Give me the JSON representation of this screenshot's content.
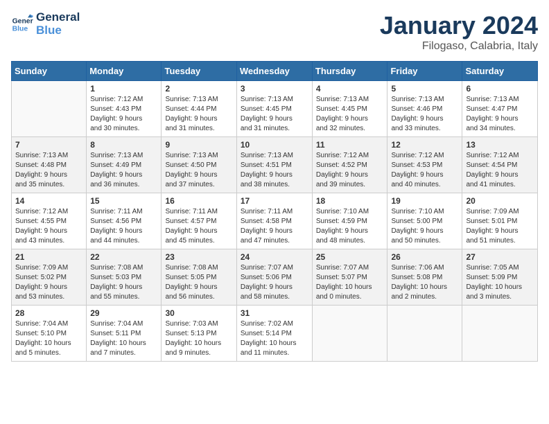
{
  "header": {
    "logo_line1": "General",
    "logo_line2": "Blue",
    "month": "January 2024",
    "location": "Filogaso, Calabria, Italy"
  },
  "weekdays": [
    "Sunday",
    "Monday",
    "Tuesday",
    "Wednesday",
    "Thursday",
    "Friday",
    "Saturday"
  ],
  "weeks": [
    [
      {
        "day": "",
        "info": ""
      },
      {
        "day": "1",
        "info": "Sunrise: 7:12 AM\nSunset: 4:43 PM\nDaylight: 9 hours\nand 30 minutes."
      },
      {
        "day": "2",
        "info": "Sunrise: 7:13 AM\nSunset: 4:44 PM\nDaylight: 9 hours\nand 31 minutes."
      },
      {
        "day": "3",
        "info": "Sunrise: 7:13 AM\nSunset: 4:45 PM\nDaylight: 9 hours\nand 31 minutes."
      },
      {
        "day": "4",
        "info": "Sunrise: 7:13 AM\nSunset: 4:45 PM\nDaylight: 9 hours\nand 32 minutes."
      },
      {
        "day": "5",
        "info": "Sunrise: 7:13 AM\nSunset: 4:46 PM\nDaylight: 9 hours\nand 33 minutes."
      },
      {
        "day": "6",
        "info": "Sunrise: 7:13 AM\nSunset: 4:47 PM\nDaylight: 9 hours\nand 34 minutes."
      }
    ],
    [
      {
        "day": "7",
        "info": "Sunrise: 7:13 AM\nSunset: 4:48 PM\nDaylight: 9 hours\nand 35 minutes."
      },
      {
        "day": "8",
        "info": "Sunrise: 7:13 AM\nSunset: 4:49 PM\nDaylight: 9 hours\nand 36 minutes."
      },
      {
        "day": "9",
        "info": "Sunrise: 7:13 AM\nSunset: 4:50 PM\nDaylight: 9 hours\nand 37 minutes."
      },
      {
        "day": "10",
        "info": "Sunrise: 7:13 AM\nSunset: 4:51 PM\nDaylight: 9 hours\nand 38 minutes."
      },
      {
        "day": "11",
        "info": "Sunrise: 7:12 AM\nSunset: 4:52 PM\nDaylight: 9 hours\nand 39 minutes."
      },
      {
        "day": "12",
        "info": "Sunrise: 7:12 AM\nSunset: 4:53 PM\nDaylight: 9 hours\nand 40 minutes."
      },
      {
        "day": "13",
        "info": "Sunrise: 7:12 AM\nSunset: 4:54 PM\nDaylight: 9 hours\nand 41 minutes."
      }
    ],
    [
      {
        "day": "14",
        "info": "Sunrise: 7:12 AM\nSunset: 4:55 PM\nDaylight: 9 hours\nand 43 minutes."
      },
      {
        "day": "15",
        "info": "Sunrise: 7:11 AM\nSunset: 4:56 PM\nDaylight: 9 hours\nand 44 minutes."
      },
      {
        "day": "16",
        "info": "Sunrise: 7:11 AM\nSunset: 4:57 PM\nDaylight: 9 hours\nand 45 minutes."
      },
      {
        "day": "17",
        "info": "Sunrise: 7:11 AM\nSunset: 4:58 PM\nDaylight: 9 hours\nand 47 minutes."
      },
      {
        "day": "18",
        "info": "Sunrise: 7:10 AM\nSunset: 4:59 PM\nDaylight: 9 hours\nand 48 minutes."
      },
      {
        "day": "19",
        "info": "Sunrise: 7:10 AM\nSunset: 5:00 PM\nDaylight: 9 hours\nand 50 minutes."
      },
      {
        "day": "20",
        "info": "Sunrise: 7:09 AM\nSunset: 5:01 PM\nDaylight: 9 hours\nand 51 minutes."
      }
    ],
    [
      {
        "day": "21",
        "info": "Sunrise: 7:09 AM\nSunset: 5:02 PM\nDaylight: 9 hours\nand 53 minutes."
      },
      {
        "day": "22",
        "info": "Sunrise: 7:08 AM\nSunset: 5:03 PM\nDaylight: 9 hours\nand 55 minutes."
      },
      {
        "day": "23",
        "info": "Sunrise: 7:08 AM\nSunset: 5:05 PM\nDaylight: 9 hours\nand 56 minutes."
      },
      {
        "day": "24",
        "info": "Sunrise: 7:07 AM\nSunset: 5:06 PM\nDaylight: 9 hours\nand 58 minutes."
      },
      {
        "day": "25",
        "info": "Sunrise: 7:07 AM\nSunset: 5:07 PM\nDaylight: 10 hours\nand 0 minutes."
      },
      {
        "day": "26",
        "info": "Sunrise: 7:06 AM\nSunset: 5:08 PM\nDaylight: 10 hours\nand 2 minutes."
      },
      {
        "day": "27",
        "info": "Sunrise: 7:05 AM\nSunset: 5:09 PM\nDaylight: 10 hours\nand 3 minutes."
      }
    ],
    [
      {
        "day": "28",
        "info": "Sunrise: 7:04 AM\nSunset: 5:10 PM\nDaylight: 10 hours\nand 5 minutes."
      },
      {
        "day": "29",
        "info": "Sunrise: 7:04 AM\nSunset: 5:11 PM\nDaylight: 10 hours\nand 7 minutes."
      },
      {
        "day": "30",
        "info": "Sunrise: 7:03 AM\nSunset: 5:13 PM\nDaylight: 10 hours\nand 9 minutes."
      },
      {
        "day": "31",
        "info": "Sunrise: 7:02 AM\nSunset: 5:14 PM\nDaylight: 10 hours\nand 11 minutes."
      },
      {
        "day": "",
        "info": ""
      },
      {
        "day": "",
        "info": ""
      },
      {
        "day": "",
        "info": ""
      }
    ]
  ]
}
